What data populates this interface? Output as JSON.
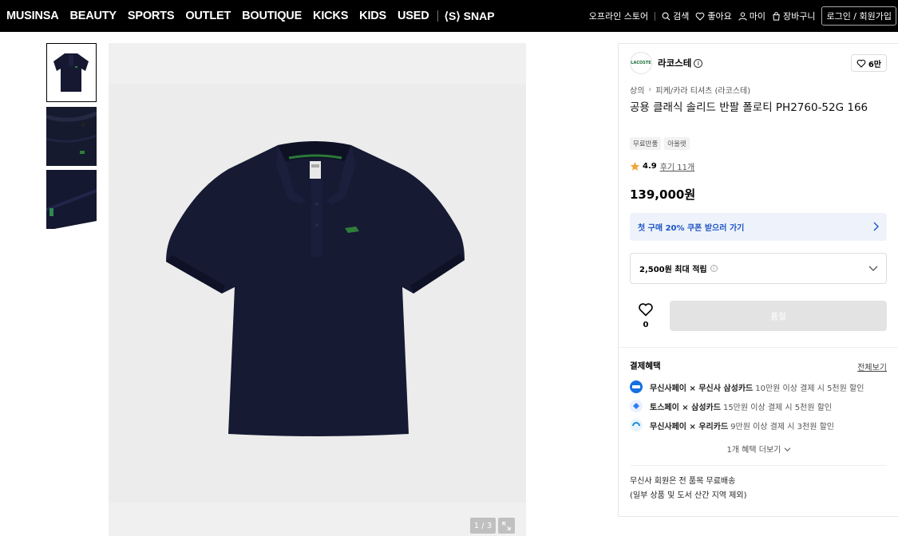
{
  "nav": {
    "brands": [
      "MUSINSA",
      "BEAUTY",
      "SPORTS",
      "OUTLET",
      "BOUTIQUE",
      "KICKS",
      "KIDS",
      "USED"
    ],
    "snap": "⟨S⟩ SNAP",
    "offline_store": "오프라인 스토어",
    "search": "검색",
    "likes": "좋아요",
    "my": "마이",
    "cart": "장바구니",
    "login": "로그인 / 회원가입"
  },
  "gallery": {
    "counter": "1 / 3",
    "background_color": "#f0f0f0",
    "shirt_color": "#151830"
  },
  "product": {
    "brand_logo_text": "LACOSTE",
    "brand_name": "라코스테",
    "like_count": "6만",
    "breadcrumb": [
      "상의",
      "피케/카라 티셔츠 (라코스테)"
    ],
    "title": "공용 클래식 솔리드 반팔 폴로티 PH2760-52G 166",
    "tags": [
      "무료반품",
      "아울렛"
    ],
    "rating": "4.9",
    "reviews": "후기 11개",
    "price": "139,000원",
    "coupon": "첫 구매 20% 쿠폰 받으러 가기",
    "points": "2,500원 최대 적립",
    "wish_count": "0",
    "buy_label": "품절",
    "coupon_color": "#1d54c4"
  },
  "payment": {
    "title": "결제혜택",
    "view_all": "전체보기",
    "rows": [
      {
        "bold": "무신사페이 × 무신사 삼성카드",
        "sub": "10만원 이상 결제 시 5천원 할인",
        "icon": "musinsa-card-icon",
        "color": "#1570e0"
      },
      {
        "bold": "토스페이 × 삼성카드",
        "sub": "15만원 이상 결제 시 5천원 할인",
        "icon": "toss-icon",
        "color": "#2f7df5"
      },
      {
        "bold": "무신사페이 × 우리카드",
        "sub": "9만원 이상 결제 시 3천원 할인",
        "icon": "woori-card-icon",
        "color": "#1b8ad6"
      }
    ],
    "more": "1개 혜택 더보기"
  },
  "shipping": {
    "line1": "무신사 회원은 전 품목 무료배송",
    "line2": "(일부 상품 및 도서 산간 지역 제외)"
  }
}
